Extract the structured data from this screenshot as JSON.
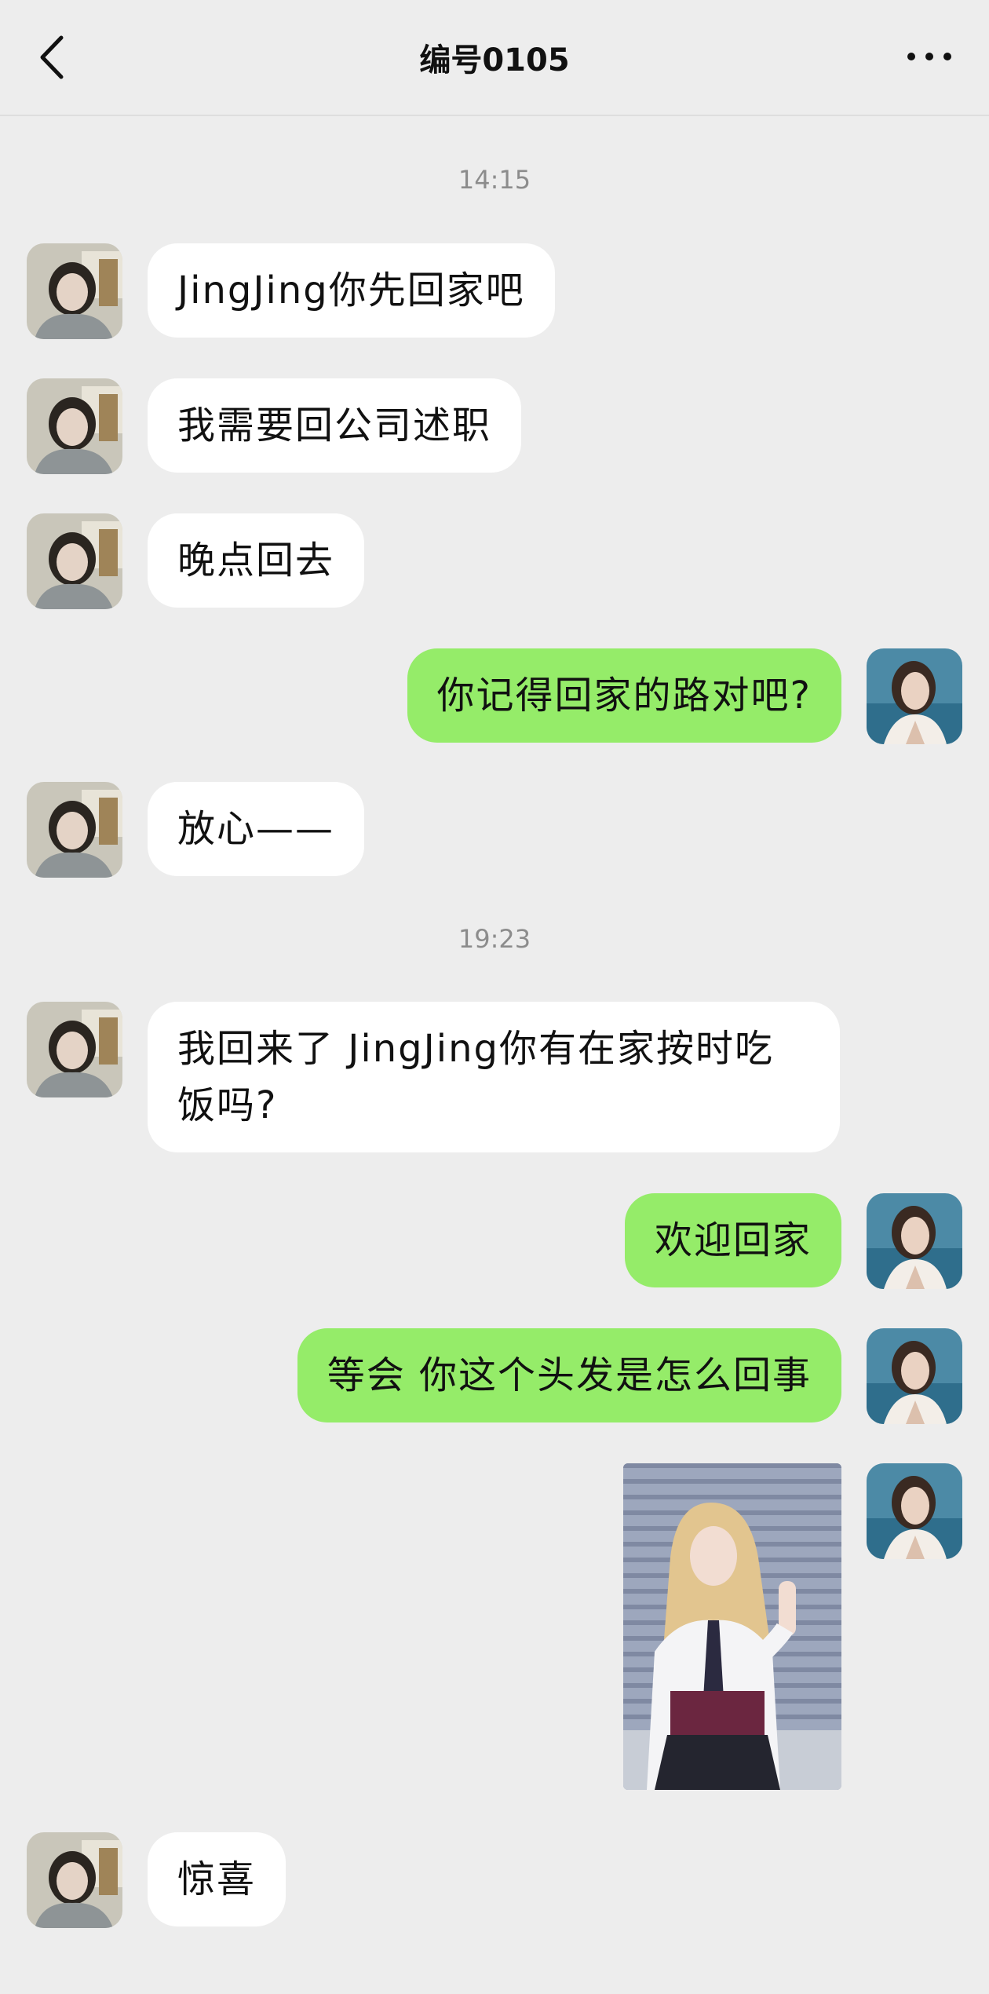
{
  "header": {
    "back_icon": "chevron-left-icon",
    "title": "编号0105",
    "more_icon": "ellipsis-icon"
  },
  "chat": {
    "time1": "14:15",
    "time2": "19:23",
    "messages": [
      {
        "side": "in",
        "text": "JingJing你先回家吧"
      },
      {
        "side": "in",
        "text": "我需要回公司述职"
      },
      {
        "side": "in",
        "text": "晚点回去"
      },
      {
        "side": "out",
        "text": "你记得回家的路对吧?"
      },
      {
        "side": "in",
        "text": "放心——"
      },
      {
        "side": "in",
        "text": "我回来了 JingJing你有在家按时吃饭吗?"
      },
      {
        "side": "out",
        "text": "欢迎回家"
      },
      {
        "side": "out",
        "text": "等会 你这个头发是怎么回事"
      },
      {
        "side": "out",
        "type": "image"
      },
      {
        "side": "in",
        "text": "惊喜"
      }
    ]
  },
  "colors": {
    "background": "#ededed",
    "bubble_in": "#ffffff",
    "bubble_out": "#95ec69",
    "time_text": "#8c8c8c"
  }
}
